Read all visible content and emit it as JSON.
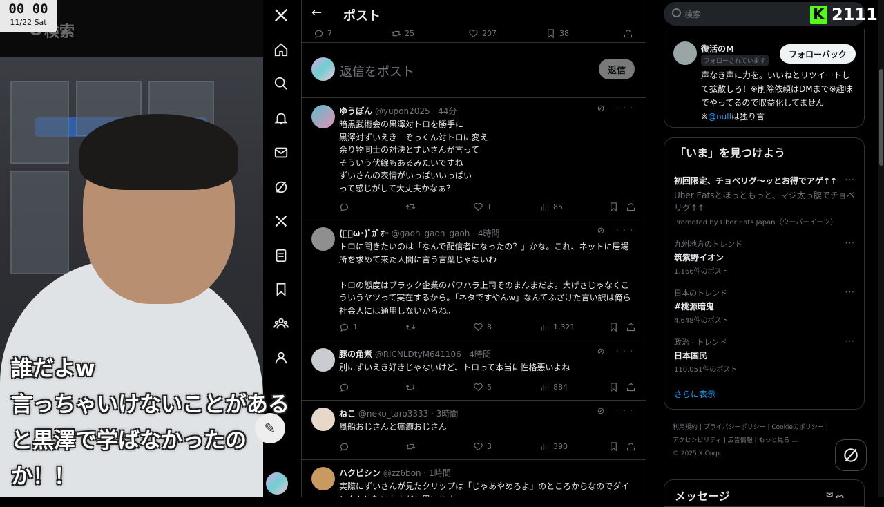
{
  "stream": {
    "clock_time": "00 00",
    "clock_date": "11/22 Sat",
    "ghost_search": "検索",
    "caption_lines": [
      "誰だよw",
      "言っちゃいけないことがある",
      "と黒澤で学ばなかったの",
      "か！！"
    ]
  },
  "nav": {
    "items": [
      "x-logo-icon",
      "home-icon",
      "search-icon",
      "bell-icon",
      "mail-icon",
      "grok-icon",
      "x-premium-icon",
      "list-icon",
      "bookmark-icon",
      "communities-icon",
      "profile-icon"
    ]
  },
  "main": {
    "back_icon": "←",
    "title": "ポスト",
    "top_actions": {
      "replies": "7",
      "reposts": "25",
      "likes": "207",
      "bookmarks": "38"
    },
    "reply_placeholder": "返信をポスト",
    "reply_button": "返信",
    "tweets": [
      {
        "name": "ゆうぽん",
        "handle": "@yupon2025 · 44分",
        "text": "暗黒武術会の黒澤対トロを勝手に\n黒澤対ずいえき　ぞっくん対トロに変え\n余り物同士の対決とずいさんが言って\nそういう伏線もあるみたいですね\nずいさんの表情がいっぱいいっぱい\nって感じがして大丈夫かなぁ？",
        "replies": "",
        "reposts": "",
        "likes": "1",
        "views": "85",
        "avatar_color": "#5bbdc8"
      },
      {
        "name": "(ﾟ･ω･)ﾟｶﾞｵｰ",
        "handle": "@gaoh_gaoh_gaoh · 4時間",
        "text": "トロに聞きたいのは「なんで配信者になったの？」かな。これ、ネットに居場所を求めて来た人間に言う言葉じゃないわ\n\nトロの態度はブラック企業のパワハラ上司そのまんまだよ。大げさじゃなくこういうヤツって実在するから。「ネタですやんw」なんてふざけた言い訳は俺ら社会人には通用しないからね。",
        "replies": "1",
        "reposts": "",
        "likes": "8",
        "views": "1,321",
        "avatar_color": "#9a9a9a"
      },
      {
        "name": "豚の角煮",
        "handle": "@RlCNLDtyM641106 · 4時間",
        "text": "別にずいえき好きじゃないけど、トロって本当に性格悪いよね",
        "replies": "",
        "reposts": "",
        "likes": "5",
        "views": "884",
        "avatar_color": "#c9cdd1"
      },
      {
        "name": "ねこ",
        "handle": "@neko_taro3333 · 3時間",
        "text": "風船おじさんと瘋癲おじさん",
        "replies": "",
        "reposts": "",
        "likes": "3",
        "views": "390",
        "avatar_color": "#e8d8c8"
      },
      {
        "name": "ハクビシン",
        "handle": "@zz6bon · 1時間",
        "text": "実際にずいさんが見たクリップは「じゃあやめろよ」のところからなのでダイレクトに効いたんだと思います",
        "replies": "",
        "reposts": "",
        "likes": "",
        "views": "",
        "avatar_color": "#c89a60"
      }
    ]
  },
  "sidebar": {
    "search_placeholder": "検索",
    "kick_logo": "K",
    "viewer_count": "2111",
    "profile": {
      "name": "復活のM",
      "follows_you": "フォローされています",
      "follow_back": "フォローバック",
      "bio": "声なき声に力を。いいねとリツイートして拡散しろ！※削除依頼はDMまで※趣味でやってるので収益化してません",
      "mention": "@null",
      "bio_suffix": "は独り言"
    },
    "trends_title": "「いま」を見つけよう",
    "promo": {
      "title": "初回限定、チョベリグ〜ッとお得でアゲ↑↑",
      "desc": "Uber Eatsとほっともっと、マジ太っ腹でチョベリグ↑↑",
      "promoted": "Promoted by Uber Eats Japan（ウーバーイーツ）"
    },
    "trends": [
      {
        "context": "九州地方のトレンド",
        "name": "筑紫野イオン",
        "count": "1,166件のポスト"
      },
      {
        "context": "日本のトレンド",
        "name": "#桃源暗鬼",
        "count": "4,648件のポスト"
      },
      {
        "context": "政治 · トレンド",
        "name": "日本国民",
        "count": "110,051件のポスト"
      }
    ],
    "show_more": "さらに表示",
    "footer_links": [
      "利用規約",
      "プライバシーポリシー",
      "Cookieのポリシー",
      "アクセシビリティ",
      "広告情報",
      "もっと見る …"
    ],
    "copyright": "© 2025 X Corp.",
    "messages": "メッセージ"
  },
  "colors": {
    "accent": "#1d9bf0",
    "kick_green": "#53fc18",
    "border": "#2f3336",
    "muted": "#71767b"
  }
}
